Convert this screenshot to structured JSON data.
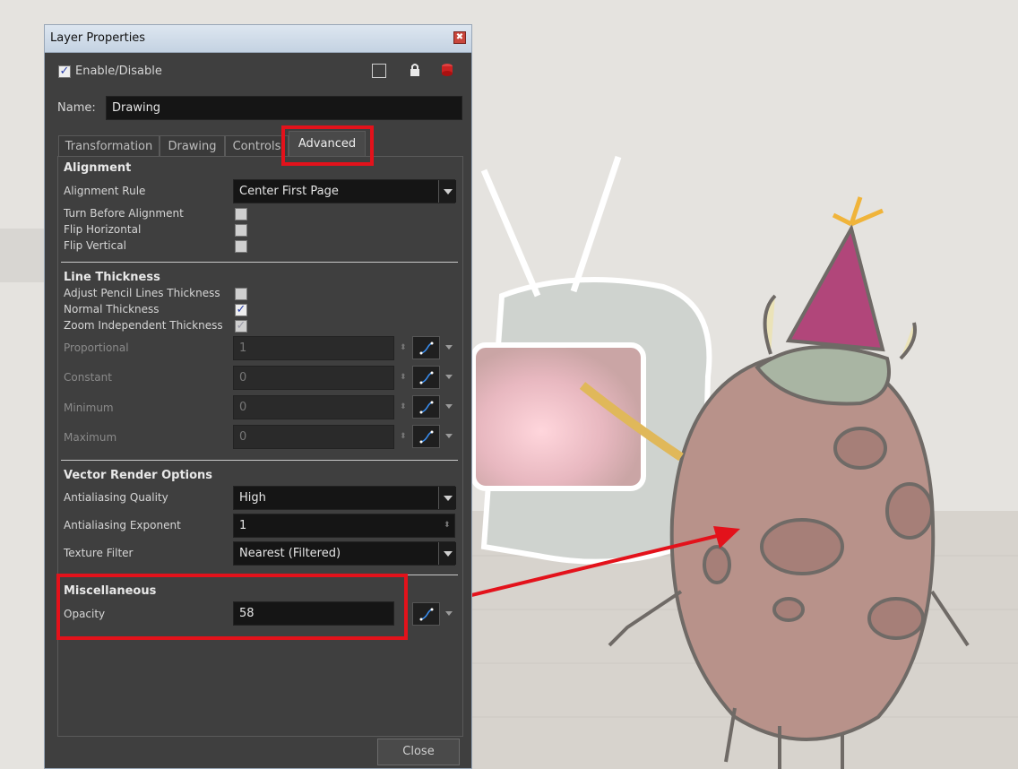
{
  "window": {
    "title": "Layer Properties",
    "close_glyph": "✖"
  },
  "top": {
    "enable_label": "Enable/Disable",
    "enable_checked": true,
    "icons": [
      "color-swatch-icon",
      "lock-icon",
      "layer-stack-icon"
    ]
  },
  "name": {
    "label": "Name:",
    "value": "Drawing"
  },
  "tabs": [
    {
      "label": "Transformation",
      "active": false
    },
    {
      "label": "Drawing",
      "active": false
    },
    {
      "label": "Controls",
      "active": false
    },
    {
      "label": "Advanced",
      "active": true
    }
  ],
  "alignment": {
    "header": "Alignment",
    "rule_label": "Alignment Rule",
    "rule_value": "Center First Page",
    "turn_before_label": "Turn Before Alignment",
    "flip_h_label": "Flip Horizontal",
    "flip_v_label": "Flip Vertical"
  },
  "line_thickness": {
    "header": "Line Thickness",
    "adjust_label": "Adjust Pencil Lines Thickness",
    "adjust_checked": false,
    "normal_label": "Normal Thickness",
    "normal_checked": true,
    "zoom_label": "Zoom Independent Thickness",
    "zoom_checked": true,
    "rows": [
      {
        "label": "Proportional",
        "value": "1"
      },
      {
        "label": "Constant",
        "value": "0"
      },
      {
        "label": "Minimum",
        "value": "0"
      },
      {
        "label": "Maximum",
        "value": "0"
      }
    ]
  },
  "vector_render": {
    "header": "Vector Render Options",
    "quality_label": "Antialiasing Quality",
    "quality_value": "High",
    "exponent_label": "Antialiasing Exponent",
    "exponent_value": "1",
    "texture_label": "Texture Filter",
    "texture_value": "Nearest (Filtered)"
  },
  "misc": {
    "header": "Miscellaneous",
    "opacity_label": "Opacity",
    "opacity_value": "58"
  },
  "buttons": {
    "close": "Close"
  },
  "colors": {
    "highlight": "#e3121b",
    "panel": "#3f3f3f",
    "field": "#151515"
  }
}
